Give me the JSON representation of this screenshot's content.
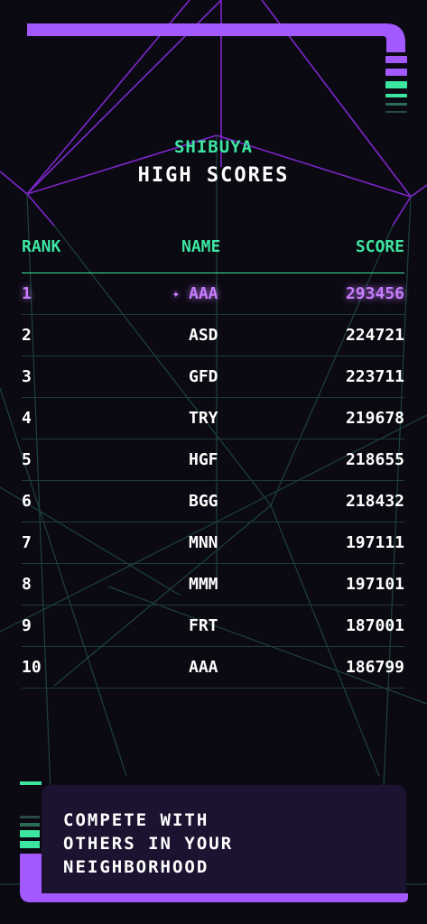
{
  "colors": {
    "background": "#0b0911",
    "accent_purple": "#a259ff",
    "accent_green": "#3de6a0",
    "highlight_text": "#c77dff"
  },
  "header": {
    "location": "SHIBUYA",
    "title": "HIGH SCORES"
  },
  "table": {
    "columns": {
      "rank": "RANK",
      "name": "NAME",
      "score": "SCORE"
    },
    "rows": [
      {
        "rank": "1",
        "name": "AAA",
        "score": "293456",
        "marker": "✦",
        "highlight": true
      },
      {
        "rank": "2",
        "name": "ASD",
        "score": "224721"
      },
      {
        "rank": "3",
        "name": "GFD",
        "score": "223711"
      },
      {
        "rank": "4",
        "name": "TRY",
        "score": "219678"
      },
      {
        "rank": "5",
        "name": "HGF",
        "score": "218655"
      },
      {
        "rank": "6",
        "name": "BGG",
        "score": "218432"
      },
      {
        "rank": "7",
        "name": "MNN",
        "score": "197111"
      },
      {
        "rank": "8",
        "name": "MMM",
        "score": "197101"
      },
      {
        "rank": "9",
        "name": "FRT",
        "score": "187001"
      },
      {
        "rank": "10",
        "name": "AAA",
        "score": "186799"
      }
    ]
  },
  "cta": {
    "lines": [
      "COMPETE WITH",
      "OTHERS IN YOUR",
      "NEIGHBORHOOD"
    ]
  },
  "icons": {
    "player_marker": "sparkle-icon"
  }
}
